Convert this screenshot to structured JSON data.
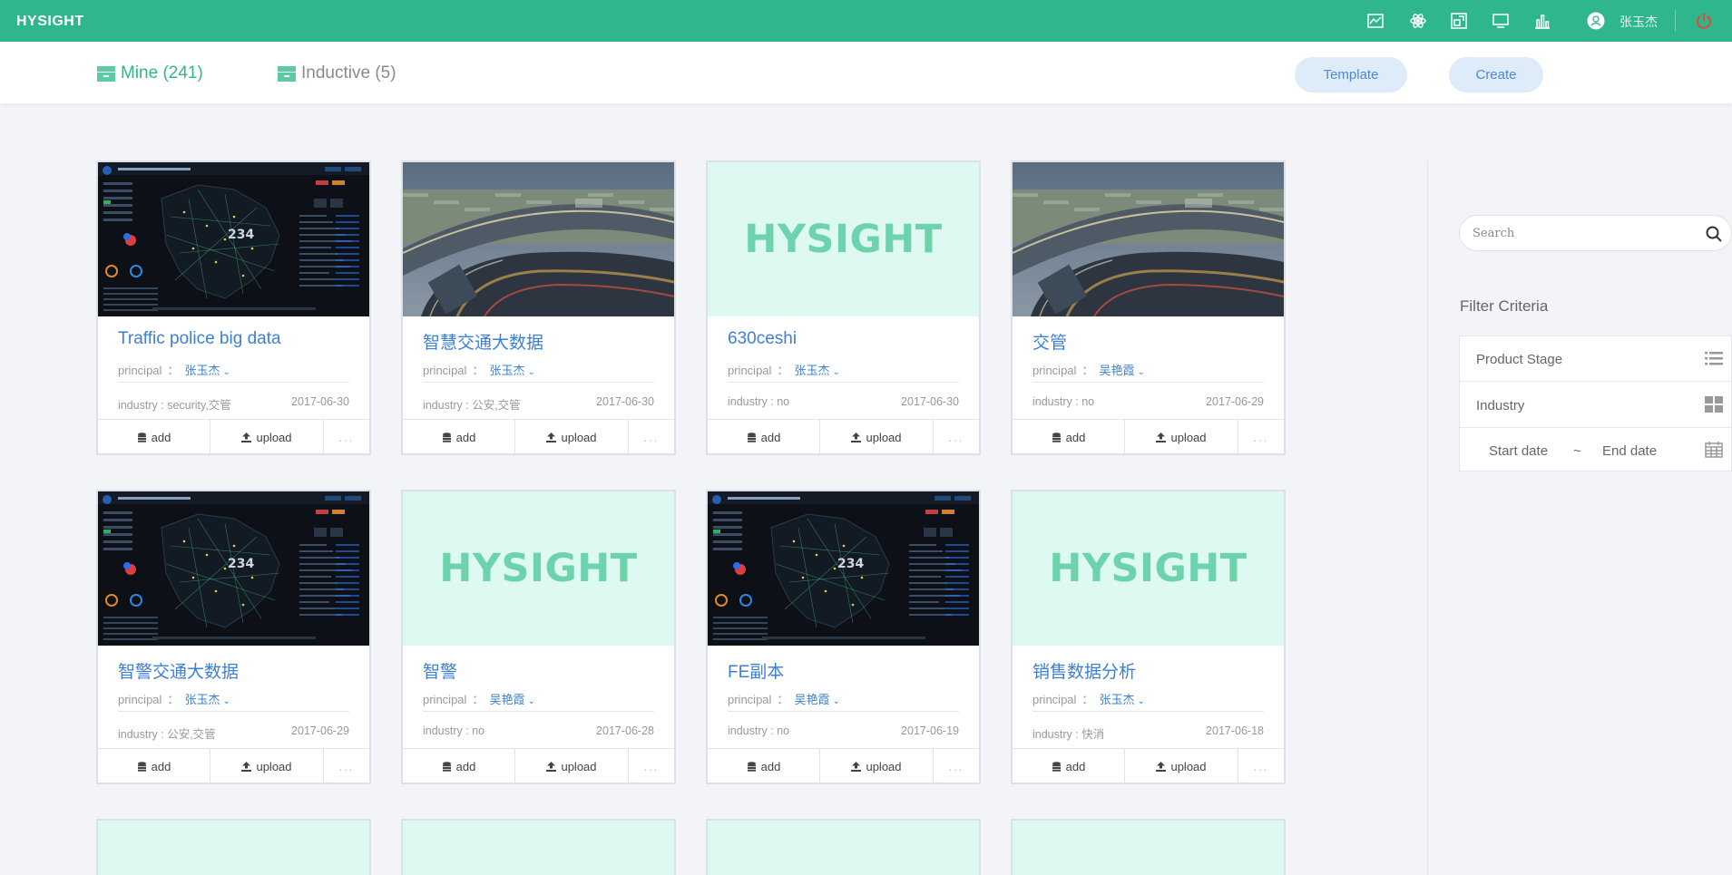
{
  "app": {
    "logo": "HYSIGHT",
    "user_name": "张玉杰"
  },
  "topbar": {
    "icons": [
      "chart-line-icon",
      "atom-icon",
      "design-icon",
      "monitor-icon",
      "bar-chart-icon",
      "user-icon",
      "power-icon"
    ]
  },
  "tabs": {
    "mine": "Mine (241)",
    "inductive": "Inductive (5)"
  },
  "buttons": {
    "template": "Template",
    "create": "Create"
  },
  "card_labels": {
    "principal": "principal",
    "colon": "：",
    "add": "add",
    "upload": "upload",
    "more": "...",
    "industry_prefix": "industry : "
  },
  "placeholder_text": "HYSIGHT",
  "cards": [
    {
      "title": "Traffic police big data",
      "principal": "张玉杰",
      "industry": "security,交管",
      "date": "2017-06-30",
      "thumb": "dashboard"
    },
    {
      "title": "智慧交通大数据",
      "principal": "张玉杰",
      "industry": "公安,交管",
      "date": "2017-06-30",
      "thumb": "airport"
    },
    {
      "title": "630ceshi",
      "principal": "张玉杰",
      "industry": "no",
      "date": "2017-06-30",
      "thumb": "hysight"
    },
    {
      "title": "交管",
      "principal": "吴艳霞",
      "industry": "no",
      "date": "2017-06-29",
      "thumb": "airport"
    },
    {
      "title": "智警交通大数据",
      "principal": "张玉杰",
      "industry": "公安,交管",
      "date": "2017-06-29",
      "thumb": "dashboard"
    },
    {
      "title": "智警",
      "principal": "吴艳霞",
      "industry": "no",
      "date": "2017-06-28",
      "thumb": "hysight"
    },
    {
      "title": "FE副本",
      "principal": "吴艳霞",
      "industry": "no",
      "date": "2017-06-19",
      "thumb": "dashboard"
    },
    {
      "title": "销售数据分析",
      "principal": "张玉杰",
      "industry": "快消",
      "date": "2017-06-18",
      "thumb": "hysight"
    }
  ],
  "sidebar": {
    "search_placeholder": "Search",
    "filter_title": "Filter Criteria",
    "product_stage": "Product Stage",
    "industry": "Industry",
    "start_date": "Start date",
    "date_separator": "~",
    "end_date": "End date"
  },
  "colors": {
    "brand": "#2fb68c",
    "link": "#3d7fd4",
    "placeholder_bg": "#ddf9f1",
    "button_bg": "#deebf9"
  }
}
